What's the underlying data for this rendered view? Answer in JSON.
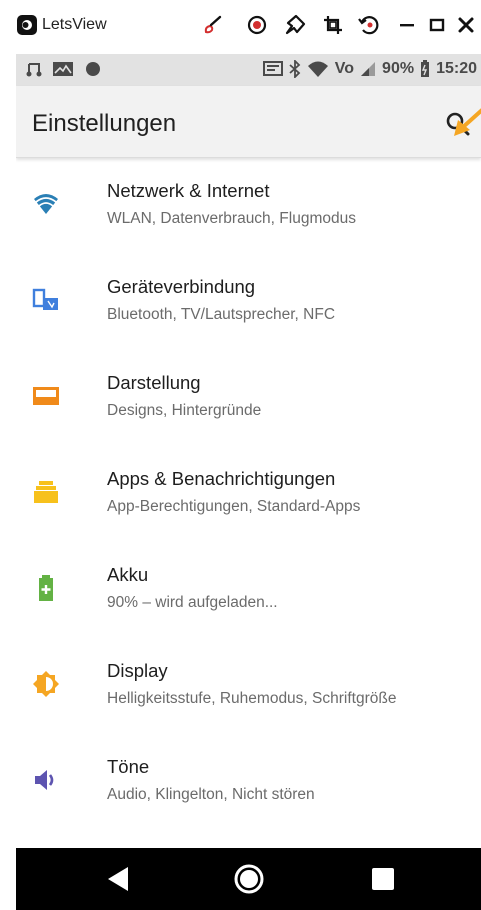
{
  "window": {
    "title": "LetsView",
    "buttons": [
      "brush-icon",
      "record-icon",
      "pin-icon",
      "crop-icon",
      "rotate-icon",
      "minimize-icon",
      "maximize-icon",
      "close-icon"
    ]
  },
  "statusbar": {
    "left_icons": [
      "music-icon",
      "image-icon",
      "circle-icon"
    ],
    "icons": [
      "cast-icon",
      "bluetooth-icon",
      "wifi-icon",
      "volte-icon",
      "signal-icon"
    ],
    "volte": "Vo",
    "battery": "90%",
    "time": "15:20"
  },
  "appbar": {
    "title": "Einstellungen"
  },
  "settings": [
    {
      "title": "Netzwerk & Internet",
      "subtitle": "WLAN, Datenverbrauch, Flugmodus",
      "icon": "wifi-icon",
      "color": "#2A7FB5"
    },
    {
      "title": "Geräteverbindung",
      "subtitle": "Bluetooth, TV/Lautsprecher, NFC",
      "icon": "devices-icon",
      "color": "#3F7FDD"
    },
    {
      "title": "Darstellung",
      "subtitle": "Designs, Hintergründe",
      "icon": "wallpaper-icon",
      "color": "#F08A1A"
    },
    {
      "title": "Apps & Benachrichtigungen",
      "subtitle": "App-Berechtigungen, Standard-Apps",
      "icon": "apps-icon",
      "color": "#F7C11C"
    },
    {
      "title": "Akku",
      "subtitle": "90% – wird aufgeladen...",
      "icon": "battery-icon",
      "color": "#63B244"
    },
    {
      "title": "Display",
      "subtitle": "Helligkeitsstufe, Ruhemodus, Schriftgröße",
      "icon": "brightness-icon",
      "color": "#F5A623"
    },
    {
      "title": "Töne",
      "subtitle": "Audio, Klingelton, Nicht stören",
      "icon": "volume-icon",
      "color": "#5D54B0"
    }
  ],
  "navbar": [
    "back-icon",
    "home-icon",
    "recents-icon"
  ],
  "accent": "#F5A623"
}
